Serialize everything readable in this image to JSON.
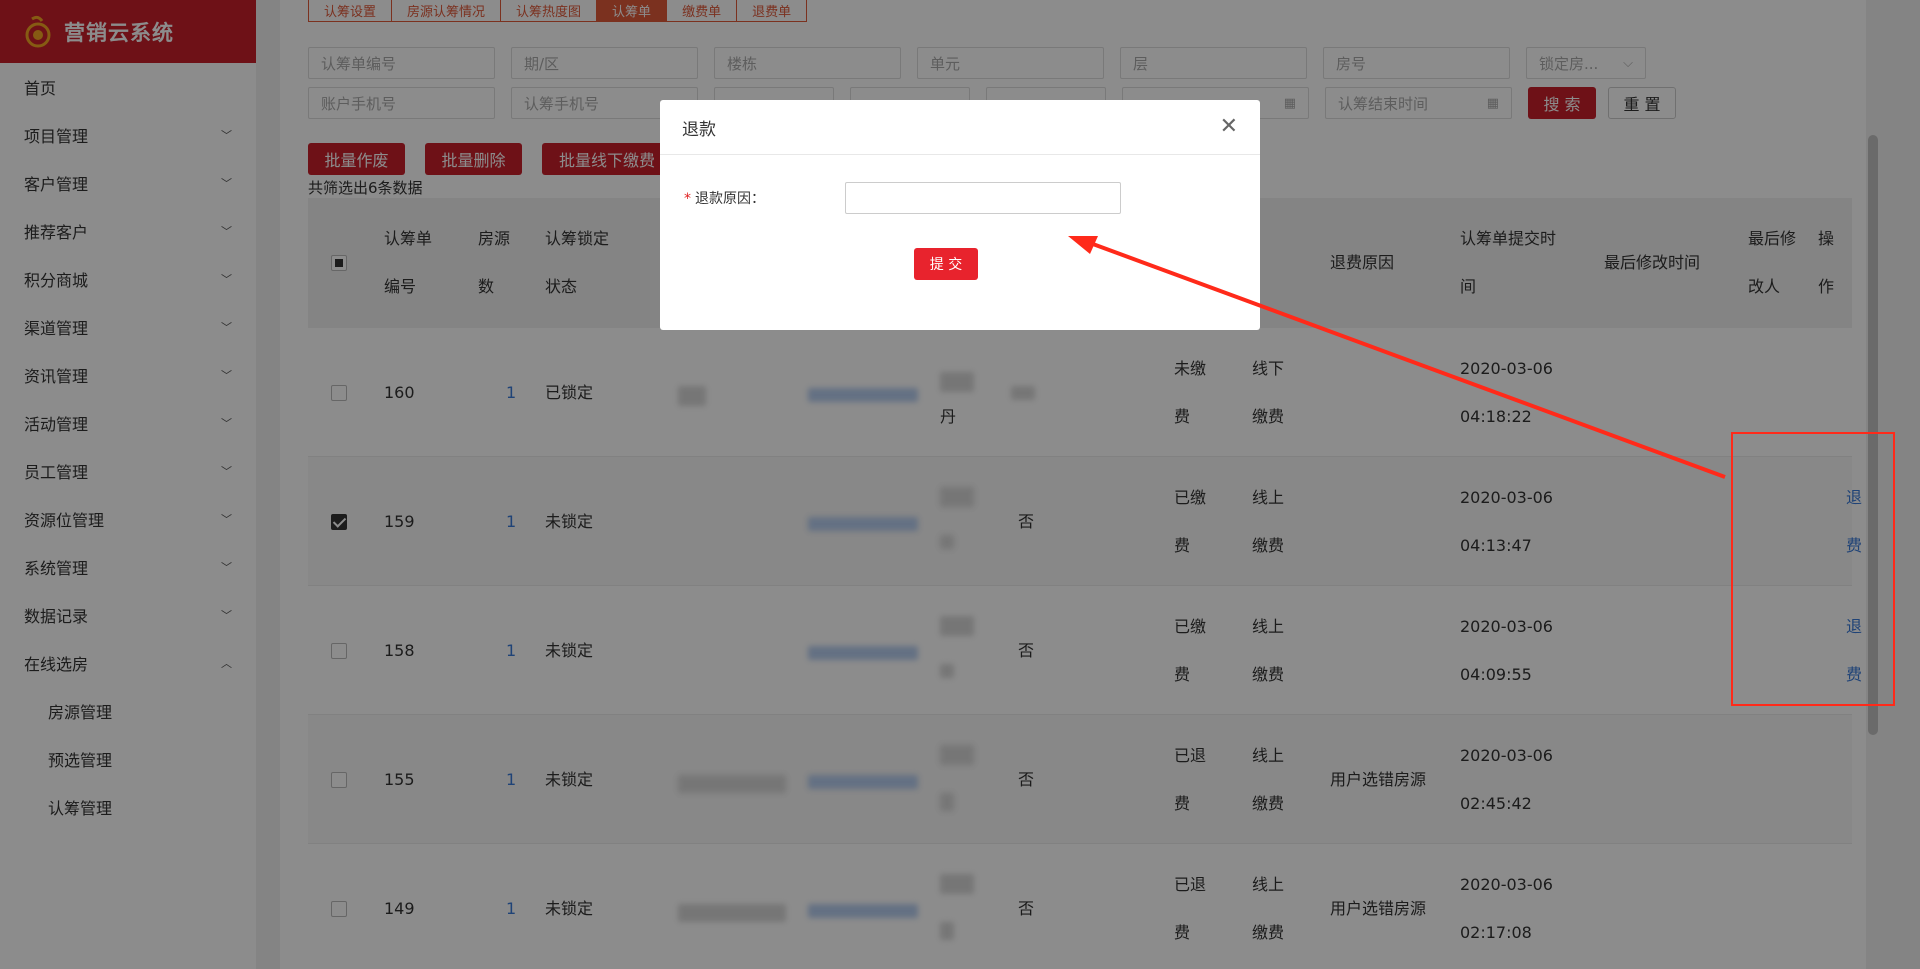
{
  "app": {
    "title": "营销云系统"
  },
  "sidebar": {
    "items": [
      {
        "label": "首页",
        "expandable": false
      },
      {
        "label": "项目管理",
        "expandable": true
      },
      {
        "label": "客户管理",
        "expandable": true
      },
      {
        "label": "推荐客户",
        "expandable": true
      },
      {
        "label": "积分商城",
        "expandable": true
      },
      {
        "label": "渠道管理",
        "expandable": true
      },
      {
        "label": "资讯管理",
        "expandable": true
      },
      {
        "label": "活动管理",
        "expandable": true
      },
      {
        "label": "员工管理",
        "expandable": true
      },
      {
        "label": "资源位管理",
        "expandable": true
      },
      {
        "label": "系统管理",
        "expandable": true
      },
      {
        "label": "数据记录",
        "expandable": true
      },
      {
        "label": "在线选房",
        "expandable": true,
        "expanded": true
      }
    ],
    "subitems": [
      "房源管理",
      "预选管理",
      "认筹管理"
    ]
  },
  "tabs": [
    {
      "label": "认筹设置",
      "active": false
    },
    {
      "label": "房源认筹情况",
      "active": false
    },
    {
      "label": "认筹热度图",
      "active": false
    },
    {
      "label": "认筹单",
      "active": true
    },
    {
      "label": "缴费单",
      "active": false
    },
    {
      "label": "退费单",
      "active": false
    }
  ],
  "filters": {
    "order_no": "认筹单编号",
    "period": "期/区",
    "building": "楼栋",
    "unit": "单元",
    "floor": "层",
    "room": "房号",
    "lock_room": "锁定房...",
    "account_phone": "账户手机号",
    "subscribe_phone": "认筹手机号",
    "end_time": "认筹结束时间"
  },
  "buttons": {
    "search": "搜 索",
    "reset": "重 置",
    "batch_void": "批量作废",
    "batch_delete": "批量删除",
    "batch_offline_pay": "批量线下缴费"
  },
  "result_count": "共筛选出6条数据",
  "table": {
    "headers": {
      "order_no": [
        "认筹单",
        "编号"
      ],
      "rooms": [
        "房源",
        "数"
      ],
      "lock_status": [
        "认筹锁定",
        "状态"
      ],
      "refund_reason": "退费原因",
      "submit_time": [
        "认筹单提交时",
        "间"
      ],
      "modified_time": "最后修改时间",
      "modifier": [
        "最后修",
        "改人"
      ],
      "action": [
        "操",
        "作"
      ]
    },
    "rows": [
      {
        "id": "160",
        "rooms": "1",
        "lock": "已锁定",
        "col_e": "丹",
        "col_f": "",
        "pay": [
          "未缴",
          "费"
        ],
        "method": [
          "线下",
          "缴费"
        ],
        "reason": "",
        "date": "2020-03-06",
        "time": "04:18:22",
        "action": [
          "",
          ""
        ],
        "checked": false
      },
      {
        "id": "159",
        "rooms": "1",
        "lock": "未锁定",
        "col_e": "",
        "col_f": "否",
        "pay": [
          "已缴",
          "费"
        ],
        "method": [
          "线上",
          "缴费"
        ],
        "reason": "",
        "date": "2020-03-06",
        "time": "04:13:47",
        "action": [
          "退",
          "费"
        ],
        "checked": true
      },
      {
        "id": "158",
        "rooms": "1",
        "lock": "未锁定",
        "col_e": "",
        "col_f": "否",
        "pay": [
          "已缴",
          "费"
        ],
        "method": [
          "线上",
          "缴费"
        ],
        "reason": "",
        "date": "2020-03-06",
        "time": "04:09:55",
        "action": [
          "退",
          "费"
        ],
        "checked": false
      },
      {
        "id": "155",
        "rooms": "1",
        "lock": "未锁定",
        "col_e": "",
        "col_f": "否",
        "pay": [
          "已退",
          "费"
        ],
        "method": [
          "线上",
          "缴费"
        ],
        "reason": "用户选错房源",
        "date": "2020-03-06",
        "time": "02:45:42",
        "action": [
          "",
          ""
        ],
        "checked": false
      },
      {
        "id": "149",
        "rooms": "1",
        "lock": "未锁定",
        "col_e": "",
        "col_f": "否",
        "pay": [
          "已退",
          "费"
        ],
        "method": [
          "线上",
          "缴费"
        ],
        "reason": "用户选错房源",
        "date": "2020-03-06",
        "time": "02:17:08",
        "action": [
          "",
          ""
        ],
        "checked": false
      }
    ]
  },
  "modal": {
    "title": "退款",
    "label": "退款原因：",
    "required_mark": "*",
    "input_value": "",
    "submit": "提 交"
  },
  "colors": {
    "brand": "#c91f2b",
    "tab_accent": "#e0593a",
    "link": "#3a7ad9",
    "annotation": "#ff2a1a"
  }
}
